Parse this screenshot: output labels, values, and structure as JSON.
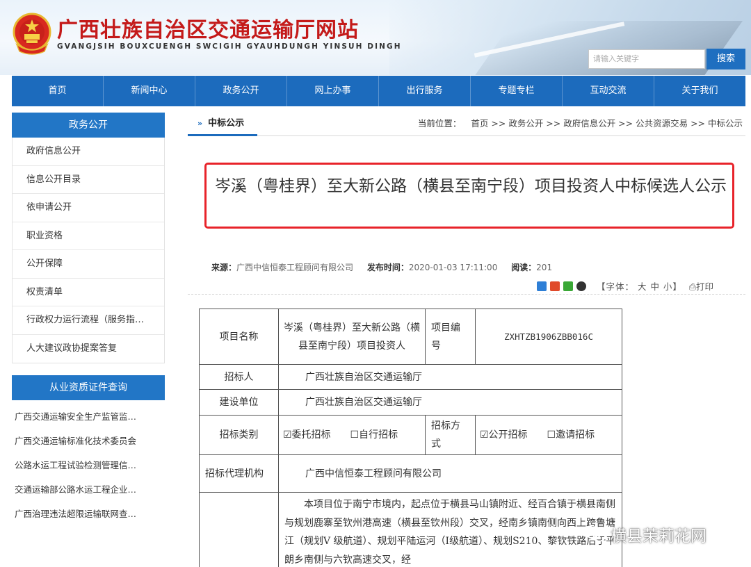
{
  "header": {
    "title": "广西壮族自治区交通运输厅网站",
    "subtitle": "GVANGJSIH BOUXCUENGH SWCIGIH GYAUHDUNGH YINSUH DINGH",
    "search_placeholder": "请输入关键字",
    "search_button": "搜索"
  },
  "nav": [
    "首页",
    "新闻中心",
    "政务公开",
    "网上办事",
    "出行服务",
    "专题专栏",
    "互动交流",
    "关于我们"
  ],
  "sidebar": {
    "section1_title": "政务公开",
    "section1_items": [
      "政府信息公开",
      "信息公开目录",
      "依申请公开",
      "职业资格",
      "公开保障",
      "权责清单",
      "行政权力运行流程（服务指…",
      "人大建议政协提案答复"
    ],
    "section2_title": "从业资质证件查询",
    "section2_items": [
      "广西交通运输安全生产监管监…",
      "广西交通运输标准化技术委员会",
      "公路水运工程试验检测管理信…",
      "交通运输部公路水运工程企业…",
      "广西治理违法超限运输联网查…"
    ]
  },
  "main": {
    "tab_label": "中标公示",
    "breadcrumb_label": "当前位置：",
    "breadcrumb_path": "首页 >> 政务公开 >> 政府信息公开 >> 公共资源交易 >> 中标公示",
    "article_title": "岑溪（粤桂界）至大新公路（横县至南宁段）项目投资人中标候选人公示",
    "meta": {
      "source_label": "来源：",
      "source": "广西中信恒泰工程顾问有限公司",
      "date_label": "发布时间：",
      "date": "2020-01-03 17:11:00",
      "views_label": "阅读：",
      "views": "201"
    },
    "tools": {
      "font_label": "【字体： 大 中 小】",
      "print_label": "打印"
    }
  },
  "table": {
    "project_name_label": "项目名称",
    "project_name": "岑溪（粤桂界）至大新公路（横县至南宁段）项目投资人",
    "project_code_label": "项目编号",
    "project_code": "ZXHTZB1906ZBB016C",
    "tenderer_label": "招标人",
    "tenderer": "广西壮族自治区交通运输厅",
    "builder_label": "建设单位",
    "builder": "广西壮族自治区交通运输厅",
    "tender_type_label": "招标类别",
    "tender_type": "☑委托招标　　☐自行招标",
    "tender_method_label": "招标方式",
    "tender_method": "☑公开招标　　☐邀请招标",
    "agency_label": "招标代理机构",
    "agency": "广西中信恒泰工程顾问有限公司",
    "description": "本项目位于南宁市境内，起点位于横县马山镇附近、经百合镇于横县南侧与规划鹿寨至钦州港高速（横县至钦州段）交叉，经南乡镇南侧向西上跨鲁塘江（规划V 级航道）、规划平陆运河（I级航道）、规划S210、黎钦铁路后于平朗乡南侧与六钦高速交叉，经"
  },
  "watermark": "横县茉莉花网",
  "colors": {
    "brand_blue": "#1c6bbd",
    "title_red": "#c41a1a",
    "highlight_red": "#e8232a"
  }
}
